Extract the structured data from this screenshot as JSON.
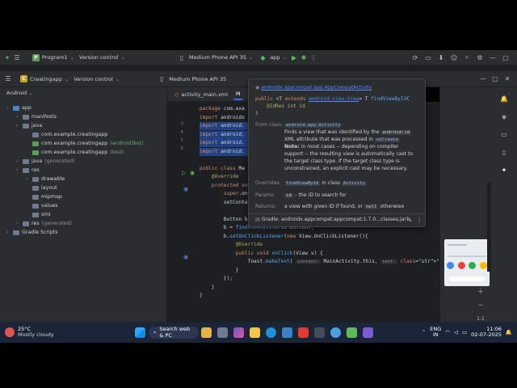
{
  "outer_window": {
    "project_badge": "P",
    "project_name": "Program1",
    "vcs_label": "Version control",
    "device": "Medium Phone API 35",
    "run_config": "app"
  },
  "inner_window": {
    "project_badge": "C",
    "project_name": "Creatingapp",
    "vcs_label": "Version control",
    "device": "Medium Phone API 35"
  },
  "project_panel": {
    "view_selector": "Android",
    "tree": [
      {
        "label": "app",
        "indent": 0,
        "color": "blue"
      },
      {
        "label": "manifests",
        "indent": 1,
        "color": "gray"
      },
      {
        "label": "java",
        "indent": 1,
        "color": "gray"
      },
      {
        "label": "com.example.creatingapp",
        "indent": 2,
        "color": "gray",
        "suffix": ""
      },
      {
        "label": "com.example.creatingapp",
        "indent": 2,
        "color": "green",
        "suffix": "(androidTest)"
      },
      {
        "label": "com.example.creatingapp",
        "indent": 2,
        "color": "green",
        "suffix": "(test)"
      },
      {
        "label": "java",
        "indent": 1,
        "color": "gray",
        "suffix": "(generated)"
      },
      {
        "label": "res",
        "indent": 1,
        "color": "gray"
      },
      {
        "label": "drawable",
        "indent": 2,
        "color": "gray"
      },
      {
        "label": "layout",
        "indent": 2,
        "color": "gray"
      },
      {
        "label": "mipmap",
        "indent": 2,
        "color": "gray"
      },
      {
        "label": "values",
        "indent": 2,
        "color": "gray"
      },
      {
        "label": "xml",
        "indent": 2,
        "color": "gray"
      },
      {
        "label": "res",
        "indent": 1,
        "color": "gray",
        "suffix": "(generated)"
      },
      {
        "label": "Gradle Scripts",
        "indent": 0,
        "color": "gray"
      }
    ]
  },
  "editor": {
    "tabs": [
      {
        "label": "activity_main.xml",
        "active": false
      },
      {
        "label": "M",
        "active": true
      }
    ],
    "line_numbers": [
      "3",
      "4",
      "5",
      "6"
    ],
    "code": [
      "package com.exa",
      "import androidx",
      "import android.",
      "import android.",
      "import android.",
      "import android.",
      "",
      "public class Ma",
      "    @Override",
      "    protected void",
      "        super.onCre",
      "        setContentV",
      "",
      "        Button b;",
      "        b = findViewById(R.id.button);",
      "        b.setOnClickListener(new View.OnClickListener(){",
      "            @Override",
      "            public void onClick(View v) {",
      "                Toast.makeText( context: MainActivity.this, text: \"Hey! This is my first",
      "            }",
      "        });",
      "    }",
      "}"
    ]
  },
  "doc_popup": {
    "class_link": "androidx.appcompat.app.AppCompatActivity",
    "signature_1": "public <T extends android.view.View> T findViewById(",
    "signature_2": "@IdRes int id",
    "signature_3": ")",
    "from_class_label": "From class:",
    "from_class_value": "android.app.Activity",
    "desc_1": "Finds a view that was identified by the",
    "desc_tag_1": "android:id",
    "desc_2": "XML attribute that was processed in",
    "desc_tag_2": "onCreate",
    "note_label": "Note:",
    "desc_3": "in most cases -- depending on compiler",
    "desc_4": "support -- the resulting view is automatically cast to",
    "desc_5": "the target class type. If the target class type is",
    "desc_6": "unconstrained, an explicit cast may be necessary.",
    "overrides_label": "Overrides:",
    "overrides_method": "findViewById",
    "overrides_in": "in class",
    "overrides_class": "Activity",
    "params_label": "Params:",
    "params_name": "id",
    "params_desc": "– the ID to search for",
    "returns_label": "Returns:",
    "returns_desc_1": "a view with given ID if found, or",
    "returns_null": "null",
    "returns_desc_2": "otherwise",
    "footer": "Gradle: androidx.appcompat:appcompat:1.7.0...classes.jar)"
  },
  "taskbar": {
    "weather_temp": "25°C",
    "weather_desc": "Mostly cloudy",
    "search_label": "Search web & PC",
    "lang_1": "ENG",
    "lang_2": "IN",
    "time": "11:06",
    "date": "02-07-2025"
  }
}
